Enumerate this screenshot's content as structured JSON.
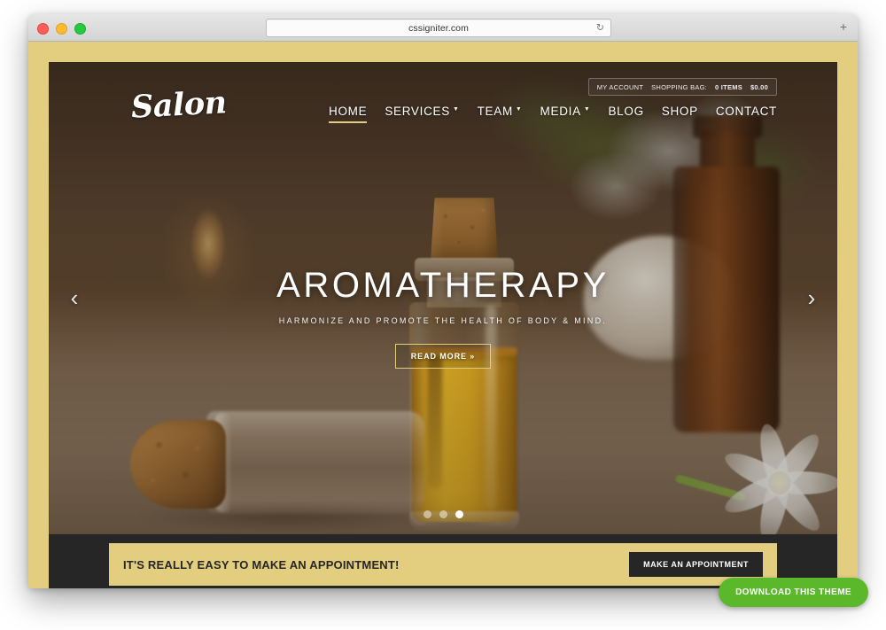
{
  "browser": {
    "url": "cssigniter.com",
    "reload_icon": "reload-icon",
    "new_tab_icon": "+",
    "traffic_lights": [
      "close",
      "minimize",
      "maximize"
    ]
  },
  "site": {
    "logo": "Salon",
    "topbar": {
      "my_account": "MY ACCOUNT",
      "shopping_bag_label": "SHOPPING BAG:",
      "item_count": "0 ITEMS",
      "total": "$0.00"
    },
    "nav": [
      {
        "label": "HOME",
        "active": true,
        "has_dropdown": false
      },
      {
        "label": "SERVICES",
        "active": false,
        "has_dropdown": true
      },
      {
        "label": "TEAM",
        "active": false,
        "has_dropdown": true
      },
      {
        "label": "MEDIA",
        "active": false,
        "has_dropdown": true
      },
      {
        "label": "BLOG",
        "active": false,
        "has_dropdown": false
      },
      {
        "label": "SHOP",
        "active": false,
        "has_dropdown": false
      },
      {
        "label": "CONTACT",
        "active": false,
        "has_dropdown": false
      }
    ],
    "hero": {
      "title": "AROMATHERAPY",
      "subtitle": "HARMONIZE AND PROMOTE THE HEALTH OF BODY & MIND.",
      "button": "READ MORE »",
      "prev_arrow": "‹",
      "next_arrow": "›",
      "slides": 3,
      "active_slide": 3
    },
    "cta": {
      "text": "IT'S REALLY EASY TO MAKE AN APPOINTMENT!",
      "button": "MAKE AN APPOINTMENT"
    },
    "download_badge": "DOWNLOAD THIS THEME"
  },
  "colors": {
    "frame_gold": "#e3cd7f",
    "footer_dark": "#262626",
    "badge_green": "#5cb82b",
    "accent_text": "#ffffff"
  }
}
